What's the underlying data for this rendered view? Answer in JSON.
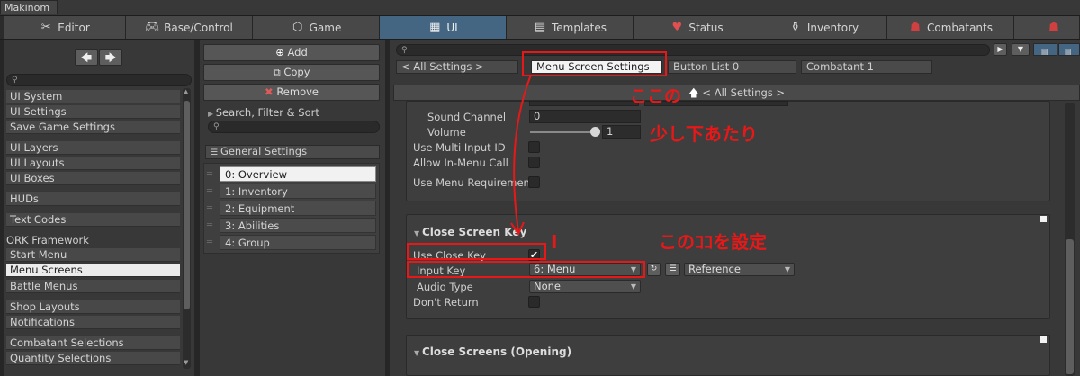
{
  "window": {
    "title": "Makinom"
  },
  "tabs": [
    {
      "label": "Editor",
      "icon": "tools-icon"
    },
    {
      "label": "Base/Control",
      "icon": "gamepad-icon"
    },
    {
      "label": "Game",
      "icon": "cube-icon"
    },
    {
      "label": "UI",
      "icon": "ui-icon"
    },
    {
      "label": "Templates",
      "icon": "document-icon"
    },
    {
      "label": "Status",
      "icon": "heart-icon"
    },
    {
      "label": "Inventory",
      "icon": "potion-icon"
    },
    {
      "label": "Combatants",
      "icon": "helmet-icon"
    }
  ],
  "sidebar": {
    "items": [
      "UI System",
      "UI Settings",
      "Save Game Settings",
      "UI Layers",
      "UI Layouts",
      "UI Boxes",
      "HUDs",
      "Text Codes",
      "Start Menu",
      "Menu Screens",
      "Battle Menus",
      "Shop Layouts",
      "Notifications",
      "Combatant Selections",
      "Quantity Selections"
    ],
    "section_label": "ORK Framework",
    "selected": "Menu Screens"
  },
  "middle": {
    "add_label": "Add",
    "copy_label": "Copy",
    "remove_label": "Remove",
    "search_label": "Search, Filter & Sort",
    "general_settings_label": "General Settings",
    "list": [
      "0: Overview",
      "1: Inventory",
      "2: Equipment",
      "3: Abilities",
      "4: Group"
    ],
    "selected_index": 0
  },
  "right": {
    "breadcrumbs": [
      "< All Settings >",
      "Menu Screen Settings",
      "Button List 0",
      "Combatant 1"
    ],
    "active_breadcrumb": "Menu Screen Settings",
    "back_button": "< All Settings >",
    "sound_channel_label": "Sound Channel",
    "sound_channel_value": "0",
    "volume_label": "Volume",
    "volume_value": "1",
    "volume_fraction": 1.0,
    "use_multi_input_label": "Use Multi Input ID",
    "allow_in_menu_label": "Allow In-Menu Call",
    "use_menu_req_label": "Use Menu Requirement",
    "close_key_header": "Close Screen Key",
    "use_close_key_label": "Use Close Key",
    "use_close_key_checked": true,
    "input_key_label": "Input Key",
    "input_key_value": "6: Menu",
    "reference_value": "Reference",
    "audio_type_label": "Audio Type",
    "audio_type_value": "None",
    "dont_return_label": "Don't Return",
    "close_screens_header": "Close Screens (Opening)"
  },
  "annotations": {
    "note1": "ここの",
    "note2": "少し下あたり",
    "note3": "このｺｺを設定",
    "bracket": "I"
  },
  "colors": {
    "accent_tab": "#456683",
    "annotation_red": "#e81818"
  }
}
